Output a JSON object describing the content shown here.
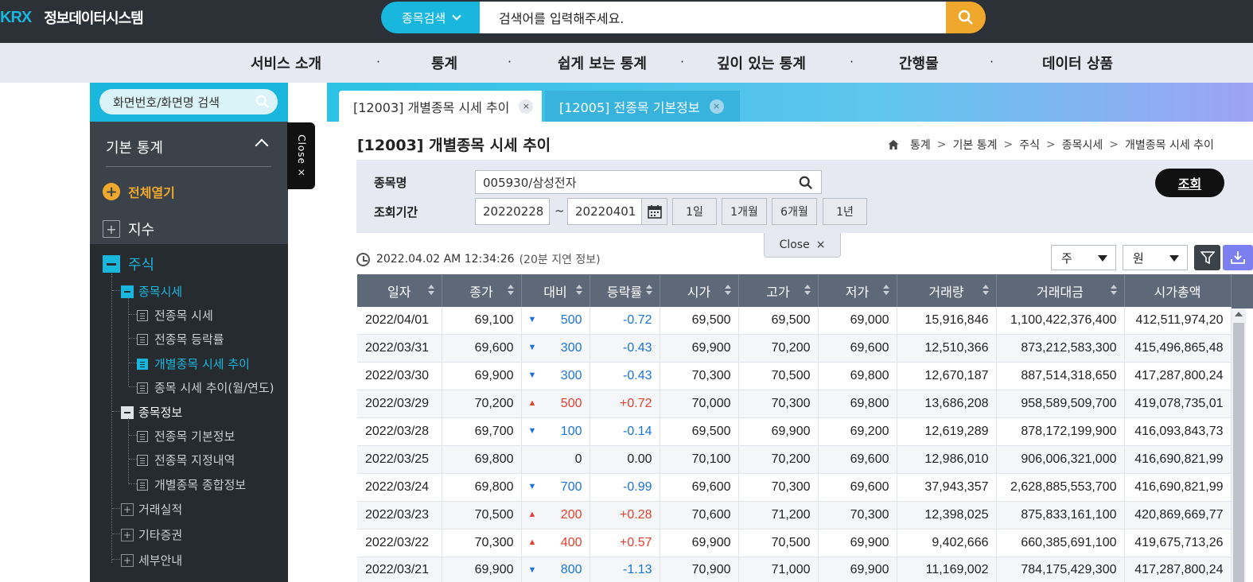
{
  "header": {
    "logo_text": "KRX",
    "site_title": "정보데이터시스템",
    "search_type": "종목검색",
    "search_placeholder": "검색어를 입력해주세요."
  },
  "nav": {
    "items": [
      "서비스 소개",
      "통계",
      "쉽게 보는 통계",
      "깊이 있는 통계",
      "간행물",
      "데이터 상품"
    ],
    "separator": "·"
  },
  "sidebar": {
    "search_placeholder": "화면번호/화면명 검색",
    "section_title": "기본 통계",
    "expand_all": "전체열기",
    "index_label": "지수",
    "stock_label": "주식",
    "price_group": "종목시세",
    "price_items": [
      "전종목 시세",
      "전종목 등락률",
      "개별종목 시세 추이",
      "종목 시세 추이(월/연도)"
    ],
    "info_group": "종목정보",
    "info_items": [
      "전종목 기본정보",
      "전종목 지정내역",
      "개별종목 종합정보"
    ],
    "other_groups": [
      "거래실적",
      "기타증권",
      "세부안내"
    ],
    "close_label": "Close ×"
  },
  "tabs": [
    {
      "label": "[12003] 개별종목 시세 추이",
      "close": "×"
    },
    {
      "label": "[12005] 전종목 기본정보",
      "close": "×"
    }
  ],
  "page": {
    "title": "[12003] 개별종목 시세 추이",
    "breadcrumb": [
      "통계",
      "기본 통계",
      "주식",
      "종목시세",
      "개별종목 시세 추이"
    ],
    "breadcrumb_sep": ">"
  },
  "filter": {
    "stock_label": "종목명",
    "stock_value": "005930/삼성전자",
    "period_label": "조회기간",
    "date_from": "20220228",
    "tilde": "~",
    "date_to": "20220401",
    "period_buttons": [
      "1일",
      "1개월",
      "6개월",
      "1년"
    ],
    "query_button": "조회",
    "close_label": "Close",
    "close_x": "×"
  },
  "result": {
    "timestamp": "2022.04.02 AM 12:34:26",
    "delay_note": "(20분 지연 정보)",
    "unit_select": "주",
    "currency_select": "원"
  },
  "table": {
    "headers": [
      "일자",
      "종가",
      "대비",
      "등락률",
      "시가",
      "고가",
      "저가",
      "거래량",
      "거래대금",
      "시가총액"
    ],
    "rows": [
      {
        "date": "2022/04/01",
        "close": "69,100",
        "dir": "down",
        "change": "500",
        "rate": "-0.72",
        "open": "69,500",
        "high": "69,500",
        "low": "69,000",
        "volume": "15,916,846",
        "amount": "1,100,422,376,400",
        "mcap": "412,511,974,20"
      },
      {
        "date": "2022/03/31",
        "close": "69,600",
        "dir": "down",
        "change": "300",
        "rate": "-0.43",
        "open": "69,900",
        "high": "70,200",
        "low": "69,600",
        "volume": "12,510,366",
        "amount": "873,212,583,300",
        "mcap": "415,496,865,48"
      },
      {
        "date": "2022/03/30",
        "close": "69,900",
        "dir": "down",
        "change": "300",
        "rate": "-0.43",
        "open": "70,300",
        "high": "70,500",
        "low": "69,800",
        "volume": "12,670,187",
        "amount": "887,514,318,650",
        "mcap": "417,287,800,24"
      },
      {
        "date": "2022/03/29",
        "close": "70,200",
        "dir": "up",
        "change": "500",
        "rate": "+0.72",
        "open": "70,000",
        "high": "70,300",
        "low": "69,800",
        "volume": "13,686,208",
        "amount": "958,589,509,700",
        "mcap": "419,078,735,01"
      },
      {
        "date": "2022/03/28",
        "close": "69,700",
        "dir": "down",
        "change": "100",
        "rate": "-0.14",
        "open": "69,500",
        "high": "69,900",
        "low": "69,200",
        "volume": "12,619,289",
        "amount": "878,172,199,900",
        "mcap": "416,093,843,73"
      },
      {
        "date": "2022/03/25",
        "close": "69,800",
        "dir": "flat",
        "change": "0",
        "rate": "0.00",
        "open": "70,100",
        "high": "70,200",
        "low": "69,600",
        "volume": "12,986,010",
        "amount": "906,006,321,000",
        "mcap": "416,690,821,99"
      },
      {
        "date": "2022/03/24",
        "close": "69,800",
        "dir": "down",
        "change": "700",
        "rate": "-0.99",
        "open": "69,600",
        "high": "70,300",
        "low": "69,600",
        "volume": "37,943,357",
        "amount": "2,628,885,553,700",
        "mcap": "416,690,821,99"
      },
      {
        "date": "2022/03/23",
        "close": "70,500",
        "dir": "up",
        "change": "200",
        "rate": "+0.28",
        "open": "70,600",
        "high": "71,200",
        "low": "70,300",
        "volume": "12,398,025",
        "amount": "875,833,161,100",
        "mcap": "420,869,669,77"
      },
      {
        "date": "2022/03/22",
        "close": "70,300",
        "dir": "up",
        "change": "400",
        "rate": "+0.57",
        "open": "69,900",
        "high": "70,500",
        "low": "69,900",
        "volume": "9,402,666",
        "amount": "660,385,691,100",
        "mcap": "419,675,713,26"
      },
      {
        "date": "2022/03/21",
        "close": "69,900",
        "dir": "down",
        "change": "800",
        "rate": "-1.13",
        "open": "70,900",
        "high": "71,000",
        "low": "69,900",
        "volume": "11,169,002",
        "amount": "784,175,429,300",
        "mcap": "417,287,800,24"
      }
    ]
  },
  "colors": {
    "accent": "#19b6dd",
    "orange": "#f0a82c",
    "up": "#e2402f",
    "down": "#1a73d9",
    "header_bg": "#5d6978"
  }
}
